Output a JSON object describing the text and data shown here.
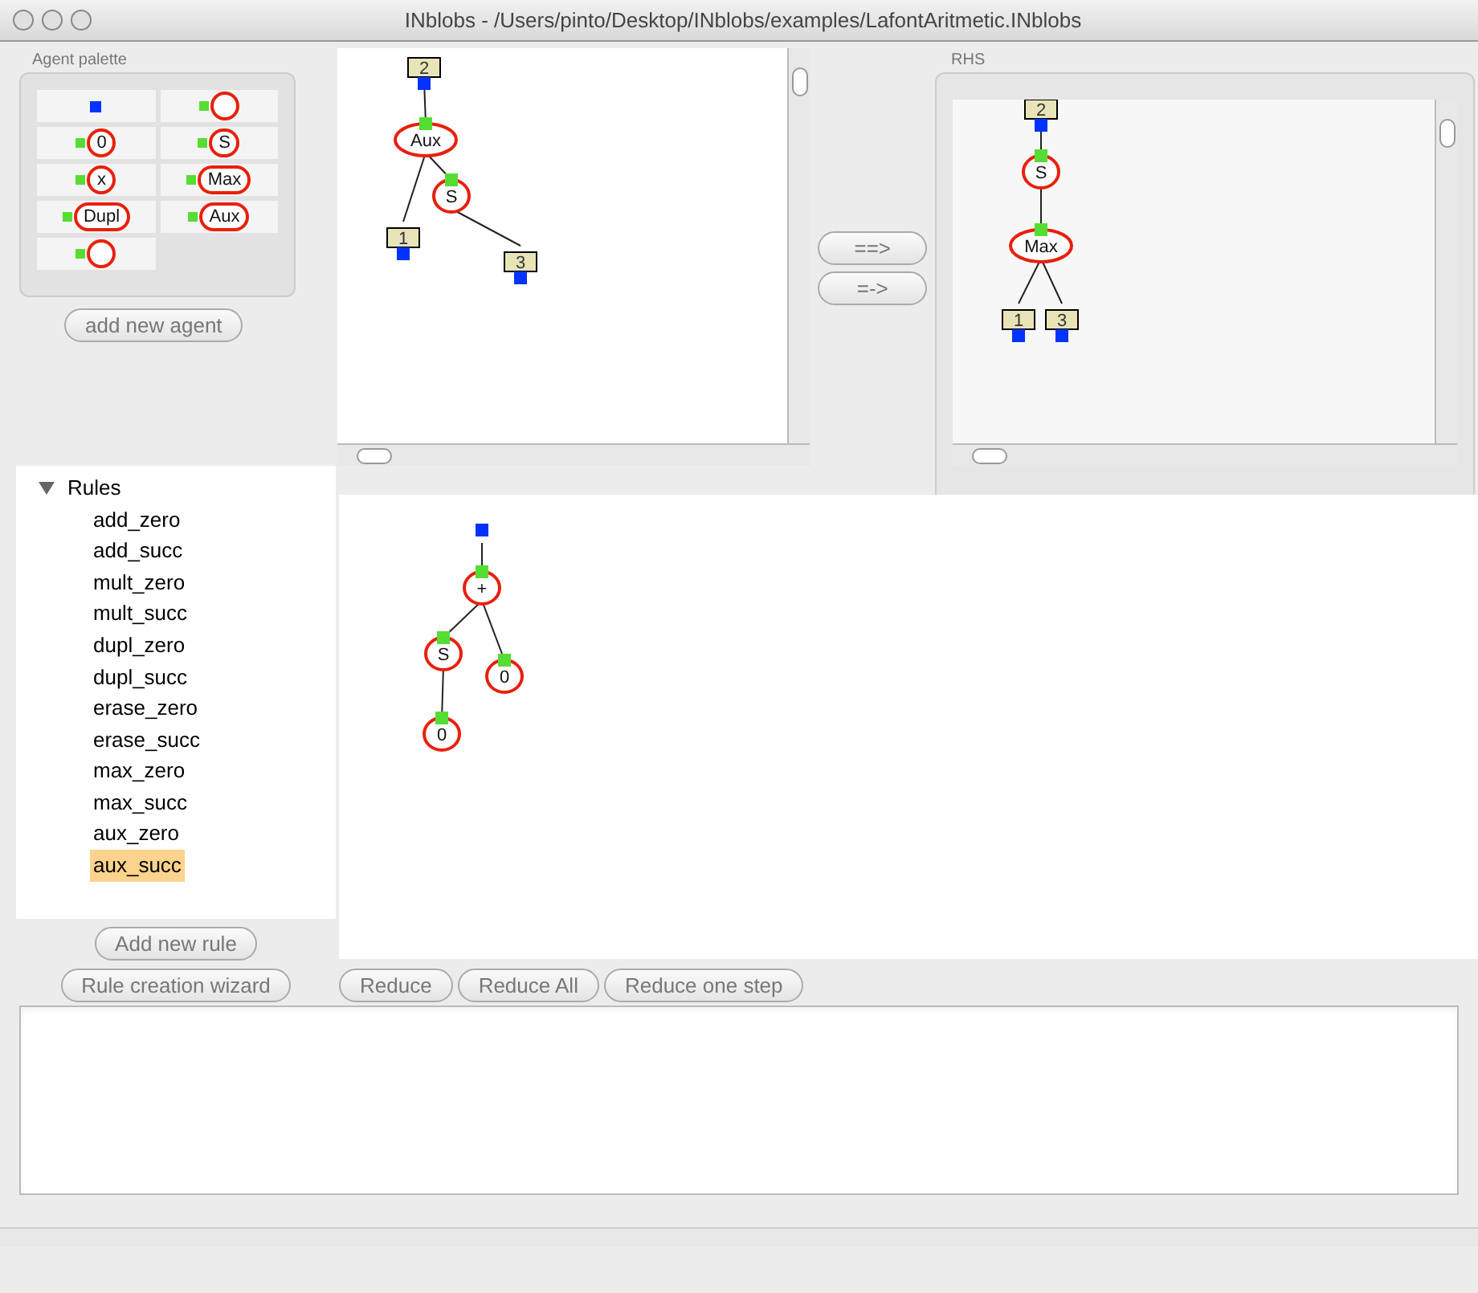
{
  "window": {
    "title": "INblobs - /Users/pinto/Desktop/INblobs/examples/LafontAritmetic.INblobs"
  },
  "agent_palette": {
    "title": "Agent palette",
    "agents": [
      {
        "kind": "interface"
      },
      {
        "kind": "agent"
      },
      {
        "kind": "agent",
        "label": "0"
      },
      {
        "kind": "agent",
        "label": "S"
      },
      {
        "kind": "agent",
        "label": "x"
      },
      {
        "kind": "agent",
        "label": "Max"
      },
      {
        "kind": "agent",
        "label": "Dupl"
      },
      {
        "kind": "agent",
        "label": "Aux"
      },
      {
        "kind": "agent"
      }
    ],
    "add_button": "add new agent"
  },
  "lhs": {
    "nodes": [
      {
        "kind": "box",
        "label": "2"
      },
      {
        "kind": "agent",
        "label": "Aux"
      },
      {
        "kind": "agent",
        "label": "S"
      },
      {
        "kind": "box",
        "label": "1"
      },
      {
        "kind": "box",
        "label": "3"
      }
    ]
  },
  "rewrite_buttons": [
    "==>",
    "=->"
  ],
  "rhs": {
    "title": "RHS",
    "nodes": [
      {
        "kind": "box",
        "label": "2"
      },
      {
        "kind": "agent",
        "label": "S"
      },
      {
        "kind": "agent",
        "label": "Max"
      },
      {
        "kind": "box",
        "label": "1"
      },
      {
        "kind": "box",
        "label": "3"
      }
    ]
  },
  "rules": {
    "title": "Rules",
    "expanded": true,
    "items": [
      {
        "label": "add_zero",
        "selected": false
      },
      {
        "label": "add_succ",
        "selected": false
      },
      {
        "label": "mult_zero",
        "selected": false
      },
      {
        "label": "mult_succ",
        "selected": false
      },
      {
        "label": "dupl_zero",
        "selected": false
      },
      {
        "label": "dupl_succ",
        "selected": false
      },
      {
        "label": "erase_zero",
        "selected": false
      },
      {
        "label": "erase_succ",
        "selected": false
      },
      {
        "label": "max_zero",
        "selected": false
      },
      {
        "label": "max_succ",
        "selected": false
      },
      {
        "label": "aux_zero",
        "selected": false
      },
      {
        "label": "aux_succ",
        "selected": true
      }
    ]
  },
  "add_rule_button": "Add new rule",
  "wizard_button": "Rule creation wizard",
  "net": {
    "nodes": [
      {
        "kind": "interface"
      },
      {
        "kind": "agent",
        "label": "+"
      },
      {
        "kind": "agent",
        "label": "S"
      },
      {
        "kind": "agent",
        "label": "0"
      },
      {
        "kind": "agent",
        "label": "0"
      }
    ]
  },
  "reduce_buttons": [
    "Reduce",
    "Reduce All",
    "Reduce one step"
  ]
}
